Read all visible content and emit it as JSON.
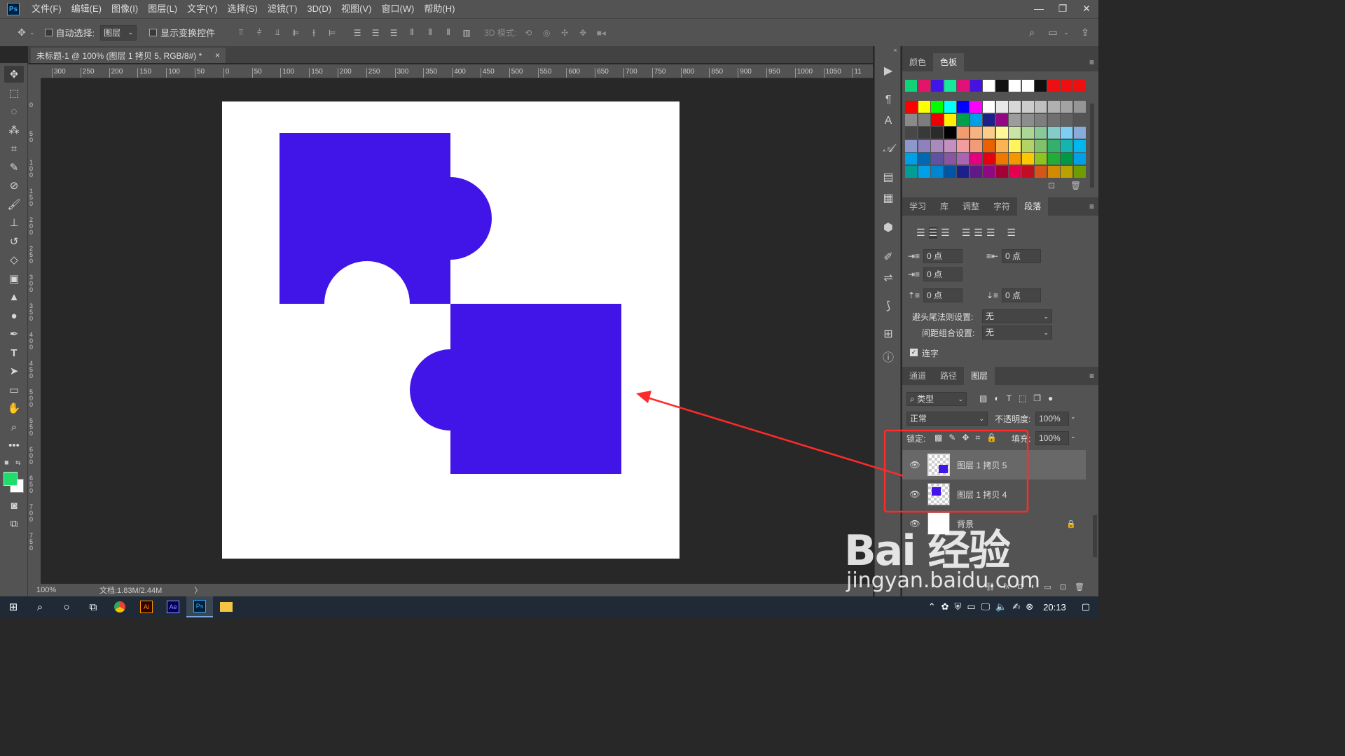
{
  "app": {
    "logo": "Ps"
  },
  "menu": [
    "文件(F)",
    "编辑(E)",
    "图像(I)",
    "图层(L)",
    "文字(Y)",
    "选择(S)",
    "滤镜(T)",
    "3D(D)",
    "视图(V)",
    "窗口(W)",
    "帮助(H)"
  ],
  "window_controls": {
    "minimize": "—",
    "restore": "❐",
    "close": "✕"
  },
  "options": {
    "auto_select_label": "自动选择:",
    "auto_select_value": "图层",
    "show_transform_label": "显示变换控件",
    "mode_3d_label": "3D 模式:"
  },
  "document": {
    "tab_title": "未标题-1 @ 100% (图层 1 拷贝 5, RGB/8#) *",
    "close": "×"
  },
  "ruler_h": [
    "300",
    "250",
    "200",
    "150",
    "100",
    "50",
    "0",
    "50",
    "100",
    "150",
    "200",
    "250",
    "300",
    "350",
    "400",
    "450",
    "500",
    "550",
    "600",
    "650",
    "700",
    "750",
    "800",
    "850",
    "900",
    "950",
    "1000",
    "1050",
    "11"
  ],
  "ruler_v": [
    "0",
    "5 0",
    "1 0 0",
    "1 5 0",
    "2 0 0",
    "2 5 0",
    "3 0 0",
    "3 5 0",
    "4 0 0",
    "4 5 0",
    "5 0 0",
    "5 5 0",
    "6 0 0",
    "6 5 0",
    "7 0 0",
    "7 5 0"
  ],
  "status": {
    "zoom": "100%",
    "doc": "文档:1.83M/2.44M",
    "arrow": "〉"
  },
  "colors": {
    "foreground": "#1fdc6b",
    "background": "#ffffff",
    "shape": "#4115e8",
    "annotation": "#ff2a2a"
  },
  "swatch_rows": [
    [
      "#11d47a",
      "#e3146a",
      "#4114e8",
      "#17e89c",
      "#e0127a",
      "#4413e0",
      "#ffffff",
      "#111111",
      "#ffffff",
      "#ffffff",
      "#111111",
      "#ee1010",
      "#ee1010",
      "#ee1010"
    ],
    [
      "#ff0000",
      "#ffff00",
      "#00ff00",
      "#00ffff",
      "#0000ff",
      "#ff00ff",
      "#ffffff",
      "#e8e8e8",
      "#d8d8d8",
      "#cccccc",
      "#bfbfbf",
      "#b0b0b0",
      "#a3a3a3",
      "#959595"
    ],
    [
      "#8a8a8a",
      "#7c7c7c",
      "#ee0000",
      "#ffee00",
      "#00a04a",
      "#00a0e9",
      "#1d2088",
      "#920783",
      "#9c9c9c",
      "#8d8d8d",
      "#7e7e7e",
      "#707070",
      "#626262",
      "#545454"
    ],
    [
      "#474747",
      "#393939",
      "#2b2b2b",
      "#000000",
      "#f19c6e",
      "#f6b37f",
      "#facd89",
      "#fff799",
      "#c9e4a4",
      "#acd598",
      "#89c997",
      "#84ccc9",
      "#7ecef4",
      "#88abda"
    ],
    [
      "#8c97cb",
      "#8f82bc",
      "#aa89bd",
      "#c490bf",
      "#f29c9f",
      "#f29b76",
      "#eb6100",
      "#f8b551",
      "#fff45c",
      "#b3d465",
      "#80c269",
      "#32b16c",
      "#13b5b1",
      "#00b7ee"
    ],
    [
      "#00a0e9",
      "#0068b7",
      "#5f52a0",
      "#8957a1",
      "#aa65b0",
      "#e4007f",
      "#e60012",
      "#ee7800",
      "#f39800",
      "#fcc800",
      "#8fc31f",
      "#22ac38",
      "#009944",
      "#00a0e9"
    ],
    [
      "#009e96",
      "#00a0e9",
      "#0086d1",
      "#0055a5",
      "#1d2088",
      "#601986",
      "#920783",
      "#a40035",
      "#e5004f",
      "#c30d23",
      "#d6561a",
      "#d28b00",
      "#b8a200",
      "#6f9c00"
    ]
  ],
  "panel_color_tabs": [
    "颜色",
    "色板"
  ],
  "panel_para_tabs": [
    "学习",
    "库",
    "调整",
    "字符",
    "段落"
  ],
  "paragraph": {
    "indent_left": "0 点",
    "indent_right": "0 点",
    "indent_first": "0 点",
    "space_before": "0 点",
    "space_after": "0 点",
    "kinsoku_label": "避头尾法则设置:",
    "kinsoku_value": "无",
    "mojikumi_label": "间距组合设置:",
    "mojikumi_value": "无",
    "hyphen_label": "连字"
  },
  "panel_layer_tabs": [
    "通道",
    "路径",
    "图层"
  ],
  "layers_panel": {
    "filter_kind": "类型",
    "blend_mode": "正常",
    "opacity_label": "不透明度:",
    "opacity_value": "100%",
    "lock_label": "锁定:",
    "fill_label": "填充:",
    "fill_value": "100%",
    "layers": [
      {
        "name": "图层 1 拷贝 5",
        "selected": true
      },
      {
        "name": "图层 1 拷贝 4",
        "selected": false
      },
      {
        "name": "背景",
        "selected": false
      }
    ]
  },
  "taskbar": {
    "time": "20:13",
    "apps": [
      "Ai",
      "Ae",
      "Ps"
    ]
  },
  "watermark": {
    "main": "Bai 经验",
    "sub": "jingyan.baidu.com"
  }
}
